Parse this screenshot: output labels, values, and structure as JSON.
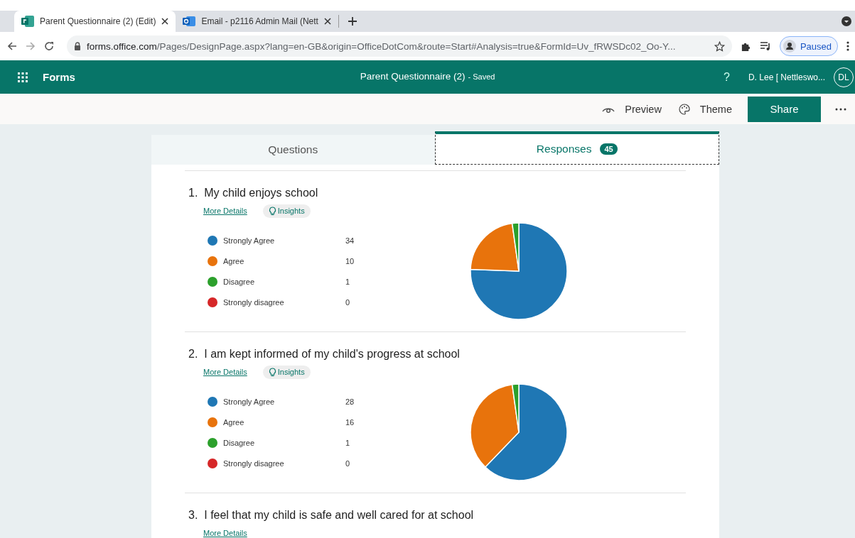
{
  "browser": {
    "tabs": [
      {
        "title": "Parent Questionnaire (2) (Edit)",
        "selected": true
      },
      {
        "title": "Email - p2116 Admin Mail (Nett",
        "selected": false
      }
    ],
    "url_host": "forms.office.com",
    "url_path": "/Pages/DesignPage.aspx?lang=en-GB&origin=OfficeDotCom&route=Start#Analysis=true&FormId=Uv_fRWSDc02_Oo-Y...",
    "profile": "Paused"
  },
  "header": {
    "app": "Forms",
    "form_title": "Parent Questionnaire (2)",
    "status": "- Saved",
    "help": "?",
    "user": "D. Lee [ Nettleswo...",
    "avatar": "DL"
  },
  "command_bar": {
    "preview": "Preview",
    "theme": "Theme",
    "share": "Share"
  },
  "form_tabs": [
    {
      "label": "Questions",
      "selected": false
    },
    {
      "label": "Responses",
      "selected": true,
      "badge": "45"
    }
  ],
  "questions": [
    {
      "number": "1.",
      "title": "My child enjoys school",
      "more_details": "More Details",
      "insights": "Insights",
      "options": [
        {
          "color": "#1f77b4",
          "count": "34"
        },
        {
          "color": "#e8730c",
          "count": "10"
        },
        {
          "color": "#2ca02c",
          "count": "1"
        },
        {
          "color": "#d62728",
          "count": "0"
        }
      ],
      "chart_data": {
        "type": "pie",
        "categories": [
          "Strongly Agree",
          "Agree",
          "Disagree",
          "Strongly disagree"
        ],
        "values": [
          75.6,
          22.2,
          2.2,
          0
        ]
      }
    },
    {
      "number": "2.",
      "title": "I am kept informed of my child's progress at school",
      "more_details": "More Details",
      "insights": "Insights",
      "options": [
        {
          "color": "#1f77b4",
          "count": "28"
        },
        {
          "color": "#e8730c",
          "count": "16"
        },
        {
          "color": "#2ca02c",
          "count": "1"
        },
        {
          "color": "#d62728",
          "count": "0"
        }
      ],
      "chart_data": {
        "type": "pie",
        "categories": [
          "Strongly Agree",
          "Agree",
          "Disagree",
          "Strongly disagree"
        ],
        "values": [
          62.2,
          35.6,
          2.2,
          0
        ]
      }
    },
    {
      "number": "3.",
      "title": "I feel that my child is safe and well cared for at school",
      "more_details": "More Details"
    }
  ]
}
